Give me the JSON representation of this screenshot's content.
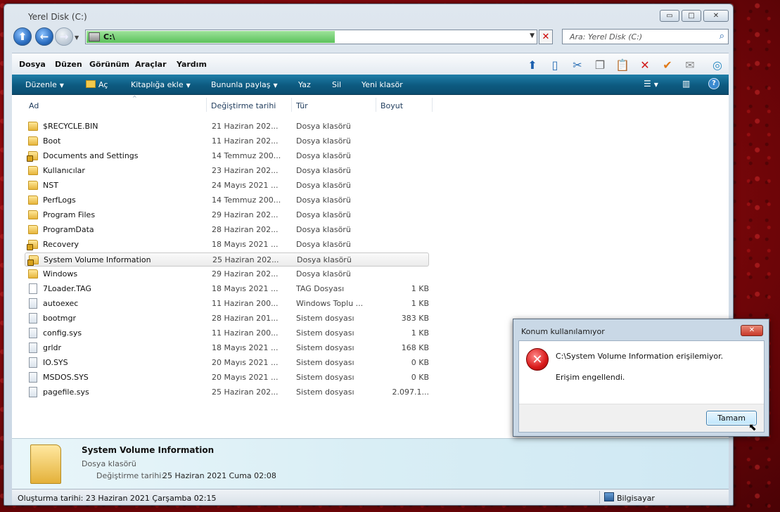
{
  "window": {
    "title": "Yerel Disk (C:)",
    "buttons": {
      "minimize": "▭",
      "maximize": "□",
      "close": "✕"
    }
  },
  "address": {
    "path": "C:\\",
    "progress": 0.55,
    "search_placeholder": "Ara: Yerel Disk (C:)"
  },
  "menu": {
    "items": [
      "Dosya",
      "Düzen",
      "Görünüm",
      "Araçlar",
      "Yardım"
    ]
  },
  "toolbar_icons": [
    "up-icon",
    "panel-icon",
    "cut-icon",
    "copy-icon",
    "paste-icon",
    "delete-icon",
    "check-icon",
    "mail-icon",
    "network-icon"
  ],
  "commands": {
    "organize": "Düzenle",
    "open": "Aç",
    "library": "Kitaplığa ekle",
    "share": "Bununla paylaş",
    "burn": "Yaz",
    "delete": "Sil",
    "new_folder": "Yeni klasör"
  },
  "columns": {
    "name": "Ad",
    "date": "Değiştirme tarihi",
    "type": "Tür",
    "size": "Boyut"
  },
  "files": [
    {
      "name": "$RECYCLE.BIN",
      "date": "21 Haziran 202...",
      "type": "Dosya klasörü",
      "size": "",
      "icon": "folder"
    },
    {
      "name": "Boot",
      "date": "11 Haziran 202...",
      "type": "Dosya klasörü",
      "size": "",
      "icon": "folder"
    },
    {
      "name": "Documents and Settings",
      "date": "14 Temmuz 200...",
      "type": "Dosya klasörü",
      "size": "",
      "icon": "folder-lock"
    },
    {
      "name": "Kullanıcılar",
      "date": "23 Haziran 202...",
      "type": "Dosya klasörü",
      "size": "",
      "icon": "folder"
    },
    {
      "name": "NST",
      "date": "24 Mayıs 2021 ...",
      "type": "Dosya klasörü",
      "size": "",
      "icon": "folder"
    },
    {
      "name": "PerfLogs",
      "date": "14 Temmuz 200...",
      "type": "Dosya klasörü",
      "size": "",
      "icon": "folder"
    },
    {
      "name": "Program Files",
      "date": "29 Haziran 202...",
      "type": "Dosya klasörü",
      "size": "",
      "icon": "folder"
    },
    {
      "name": "ProgramData",
      "date": "28 Haziran 202...",
      "type": "Dosya klasörü",
      "size": "",
      "icon": "folder"
    },
    {
      "name": "Recovery",
      "date": "18 Mayıs 2021 ...",
      "type": "Dosya klasörü",
      "size": "",
      "icon": "folder-lock"
    },
    {
      "name": "System Volume Information",
      "date": "25 Haziran 202...",
      "type": "Dosya klasörü",
      "size": "",
      "icon": "folder-lock",
      "selected": true
    },
    {
      "name": "Windows",
      "date": "29 Haziran 202...",
      "type": "Dosya klasörü",
      "size": "",
      "icon": "folder"
    },
    {
      "name": "7Loader.TAG",
      "date": "18 Mayıs 2021 ...",
      "type": "TAG Dosyası",
      "size": "1 KB",
      "icon": "file"
    },
    {
      "name": "autoexec",
      "date": "11 Haziran 200...",
      "type": "Windows Toplu ...",
      "size": "1 KB",
      "icon": "sys"
    },
    {
      "name": "bootmgr",
      "date": "28 Haziran 201...",
      "type": "Sistem dosyası",
      "size": "383 KB",
      "icon": "sys"
    },
    {
      "name": "config.sys",
      "date": "11 Haziran 200...",
      "type": "Sistem dosyası",
      "size": "1 KB",
      "icon": "sys"
    },
    {
      "name": "grldr",
      "date": "18 Mayıs 2021 ...",
      "type": "Sistem dosyası",
      "size": "168 KB",
      "icon": "sys"
    },
    {
      "name": "IO.SYS",
      "date": "20 Mayıs 2021 ...",
      "type": "Sistem dosyası",
      "size": "0 KB",
      "icon": "sys"
    },
    {
      "name": "MSDOS.SYS",
      "date": "20 Mayıs 2021 ...",
      "type": "Sistem dosyası",
      "size": "0 KB",
      "icon": "sys"
    },
    {
      "name": "pagefile.sys",
      "date": "25 Haziran 202...",
      "type": "Sistem dosyası",
      "size": "2.097.1...",
      "icon": "sys"
    }
  ],
  "details": {
    "name": "System Volume Information",
    "type": "Dosya klasörü",
    "date_label": "Değiştirme tarihi:",
    "date_value": "25 Haziran 2021 Cuma 02:08"
  },
  "status": {
    "left": "Oluşturma tarihi: 23 Haziran 2021 Çarşamba 02:15",
    "right": "Bilgisayar"
  },
  "dialog": {
    "title": "Konum kullanılamıyor",
    "message": "C:\\System Volume Information erişilemiyor.",
    "detail": "Erişim engellendi.",
    "ok": "Tamam",
    "close": "✕"
  }
}
